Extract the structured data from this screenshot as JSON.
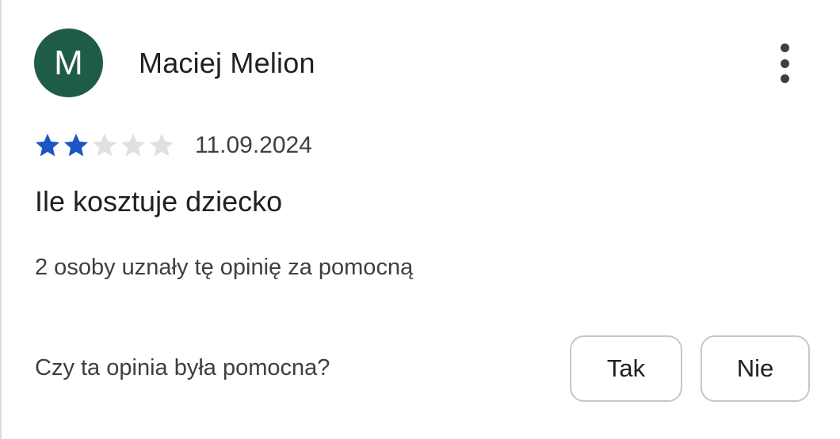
{
  "review": {
    "author": {
      "initial": "M",
      "name": "Maciej Melion",
      "avatar_color": "#1f5c47"
    },
    "menu_icon": "more-vert-icon",
    "rating": {
      "value": 2,
      "max": 5,
      "filled_color": "#1a56c4",
      "empty_color": "#e0e0e0"
    },
    "date": "11.09.2024",
    "text": "Ile kosztuje dziecko",
    "helpful_count_text": "2 osoby uznały tę opinię za pomocną",
    "helpful_prompt": {
      "question": "Czy ta opinia była pomocna?",
      "yes_label": "Tak",
      "no_label": "Nie"
    }
  }
}
